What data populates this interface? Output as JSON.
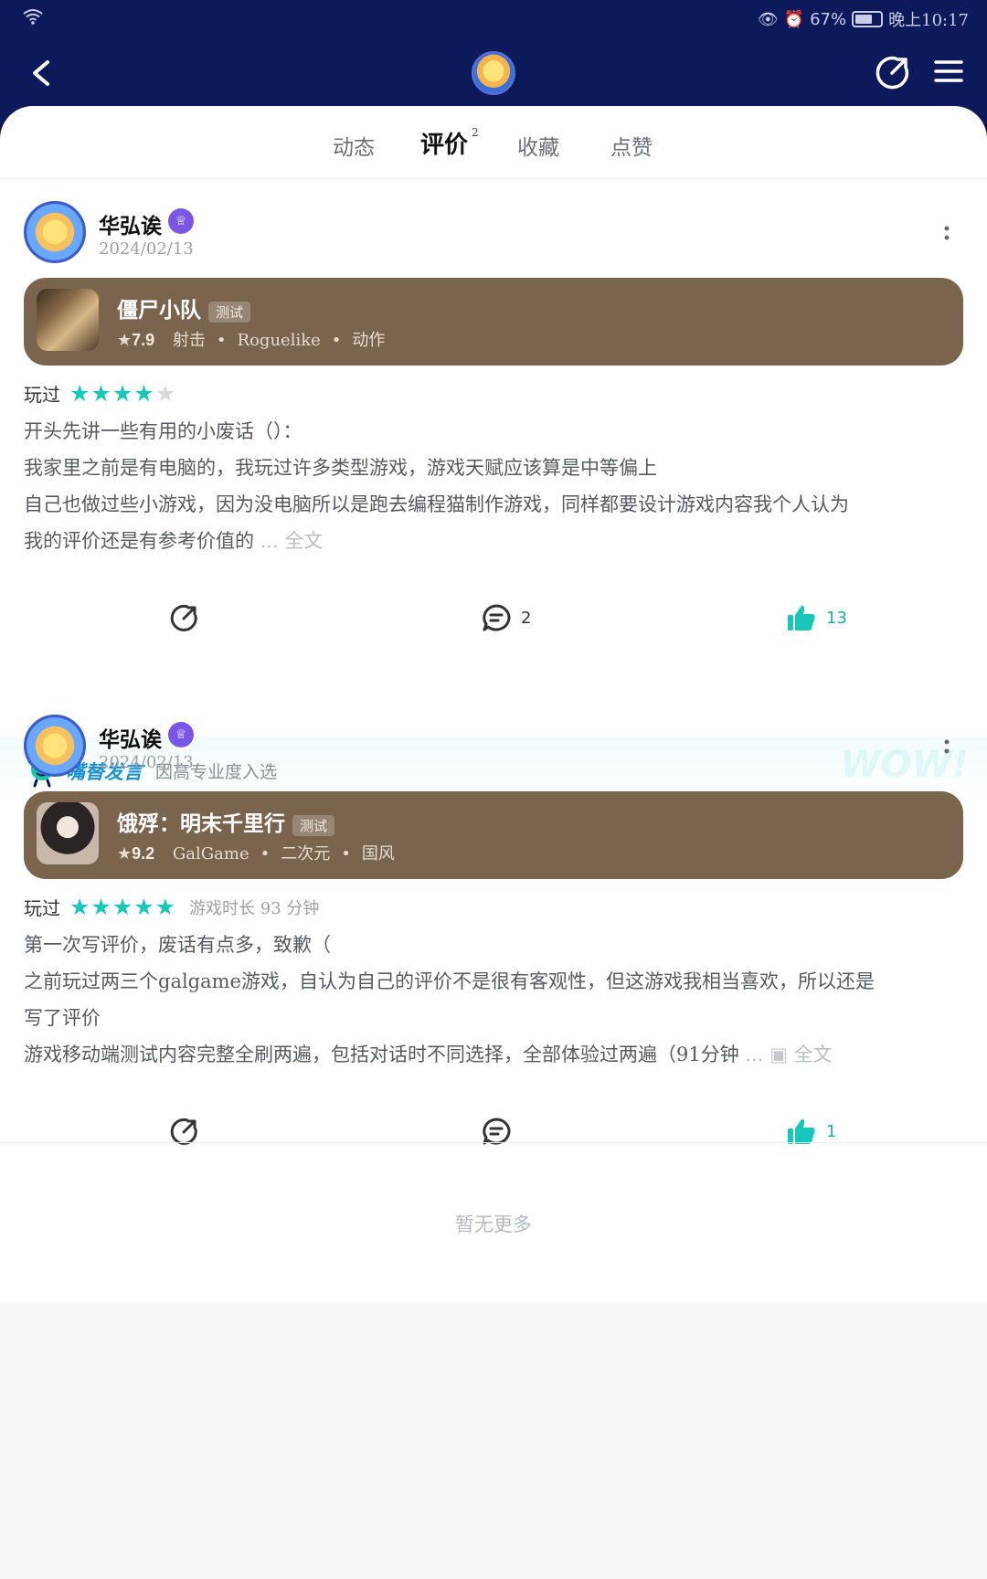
{
  "status_bar": {
    "battery": "67%",
    "time": "晚上10:17"
  },
  "tabs": [
    {
      "label": "动态"
    },
    {
      "label": "评价",
      "count": "2"
    },
    {
      "label": "收藏"
    },
    {
      "label": "点赞"
    }
  ],
  "reviews": [
    {
      "username": "华弘诶",
      "date": "2024/02/13",
      "game": {
        "name": "僵尸小队",
        "tag": "测试",
        "score": "7.9",
        "genres": [
          "射击",
          "Roguelike",
          "动作"
        ]
      },
      "status": "玩过",
      "stars": 4,
      "content": [
        "开头先讲一些有用的小废话（）：",
        "我家里之前是有电脑的，我玩过许多类型游戏，游戏天赋应该算是中等偏上",
        "自己也做过些小游戏，因为没电脑所以是跑去编程猫制作游戏，同样都要设计游戏内容我个人认为",
        "我的评价还是有参考价值的"
      ],
      "ellipsis": "...",
      "full_text": "全文",
      "comments": "2",
      "likes": "13"
    },
    {
      "username": "华弘诶",
      "date": "2024/02/13",
      "game": {
        "name": "饿殍：明末千里行",
        "tag": "测试",
        "score": "9.2",
        "genres": [
          "GalGame",
          "二次元",
          "国风"
        ]
      },
      "status": "玩过",
      "stars": 5,
      "duration": "游戏时长 93 分钟",
      "content": [
        "第一次写评价，废话有点多，致歉（",
        "之前玩过两三个galgame游戏，自认为自己的评价不是很有客观性，但这游戏我相当喜欢，所以还是",
        "写了评价",
        "游戏移动端测试内容完整全刷两遍，包括对话时不同选择，全部体验过两遍（91分钟"
      ],
      "ellipsis": "...",
      "full_text": "全文",
      "comments": "",
      "likes": "1"
    }
  ],
  "featured": {
    "label": "嘴替发言",
    "reason": "因高专业度入选",
    "watermark": "WOW!"
  },
  "no_more": "暂无更多",
  "colors": {
    "header_bg": "#0c1a5c",
    "accent": "#18c7b9",
    "game_card": "#7b644d"
  }
}
